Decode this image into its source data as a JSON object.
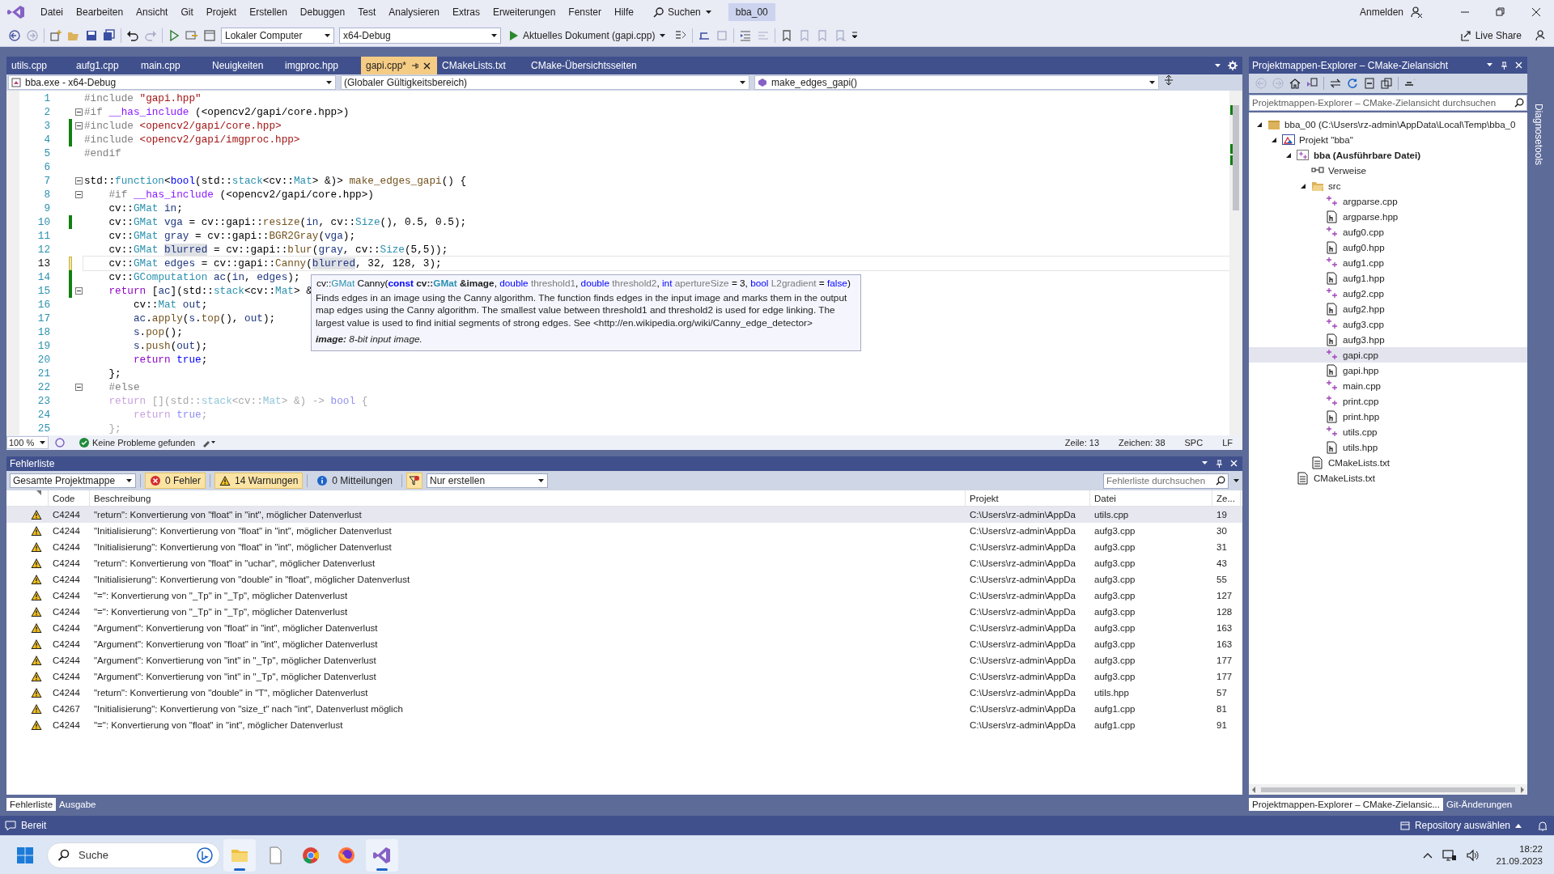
{
  "menu_bar": {
    "items": [
      "Datei",
      "Bearbeiten",
      "Ansicht",
      "Git",
      "Projekt",
      "Erstellen",
      "Debuggen",
      "Test",
      "Analysieren",
      "Extras",
      "Erweiterungen",
      "Fenster",
      "Hilfe"
    ],
    "search": "Suchen",
    "solution_name": "bba_00",
    "sign_in": "Anmelden"
  },
  "toolbar": {
    "target": "Lokaler Computer",
    "configuration": "x64-Debug",
    "run": "Aktuelles Dokument (gapi.cpp)",
    "live_share": "Live Share"
  },
  "editor": {
    "tabs": [
      {
        "label": "utils.cpp",
        "selected": false
      },
      {
        "label": "aufg1.cpp",
        "selected": false
      },
      {
        "label": "main.cpp",
        "selected": false
      },
      {
        "label": "Neuigkeiten",
        "selected": false
      },
      {
        "label": "imgproc.hpp",
        "selected": false
      },
      {
        "label": "gapi.cpp*",
        "selected": true
      },
      {
        "label": "CMakeLists.txt",
        "selected": false
      },
      {
        "label": "CMake-Übersichtsseiten",
        "selected": false
      }
    ],
    "nav": {
      "project": "bba.exe - x64-Debug",
      "scope": "(Globaler Gültigkeitsbereich)",
      "member": "make_edges_gapi()"
    },
    "lines": [
      {
        "number": "1",
        "fold": false,
        "changed": false,
        "current": false,
        "tokens": [
          {
            "kind": "pp",
            "text": "#include "
          },
          {
            "kind": "str",
            "text": "\"gapi.hpp\""
          }
        ]
      },
      {
        "number": "2",
        "fold": true,
        "changed": false,
        "current": false,
        "tokens": [
          {
            "kind": "pp",
            "text": "#if "
          },
          {
            "kind": "mac",
            "text": "__has_include"
          },
          {
            "kind": "plain",
            "text": " (<opencv2/gapi/core.hpp>)"
          }
        ]
      },
      {
        "number": "3",
        "fold": true,
        "changed": true,
        "saved": true,
        "current": false,
        "tokens": [
          {
            "kind": "pp",
            "text": "#include "
          },
          {
            "kind": "str",
            "text": "<opencv2/gapi/core.hpp>"
          }
        ]
      },
      {
        "number": "4",
        "fold": false,
        "changed": true,
        "saved": true,
        "current": false,
        "tokens": [
          {
            "kind": "pp",
            "text": "#include "
          },
          {
            "kind": "str",
            "text": "<opencv2/gapi/imgproc.hpp>"
          }
        ]
      },
      {
        "number": "5",
        "fold": false,
        "changed": false,
        "current": false,
        "tokens": [
          {
            "kind": "pp",
            "text": "#endif"
          }
        ]
      },
      {
        "number": "6",
        "fold": false,
        "changed": false,
        "current": false
      },
      {
        "number": "7",
        "fold": true,
        "changed": false,
        "current": false,
        "tokens": [
          {
            "kind": "plain",
            "text": "std::"
          },
          {
            "kind": "type",
            "text": "function"
          },
          {
            "kind": "plain",
            "text": "<"
          },
          {
            "kind": "kw",
            "text": "bool"
          },
          {
            "kind": "plain",
            "text": "(std::"
          },
          {
            "kind": "type",
            "text": "stack"
          },
          {
            "kind": "plain",
            "text": "<cv::"
          },
          {
            "kind": "type",
            "text": "Mat"
          },
          {
            "kind": "plain",
            "text": "> &)> "
          },
          {
            "kind": "fn",
            "text": "make_edges_gapi"
          },
          {
            "kind": "plain",
            "text": "() {"
          }
        ]
      },
      {
        "number": "8",
        "fold": true,
        "changed": false,
        "current": false,
        "tokens": [
          {
            "kind": "pp",
            "text": "    #if "
          },
          {
            "kind": "mac",
            "text": "__has_include"
          },
          {
            "kind": "plain",
            "text": " (<opencv2/gapi/core.hpp>)"
          }
        ]
      },
      {
        "number": "9",
        "fold": false,
        "changed": false,
        "current": false,
        "tokens": [
          {
            "kind": "plain",
            "text": "    cv::"
          },
          {
            "kind": "type",
            "text": "GMat"
          },
          {
            "kind": "var",
            "text": " in"
          },
          {
            "kind": "plain",
            "text": ";"
          }
        ]
      },
      {
        "number": "10",
        "fold": false,
        "changed": true,
        "saved": true,
        "current": false,
        "tokens": [
          {
            "kind": "plain",
            "text": "    cv::"
          },
          {
            "kind": "type",
            "text": "GMat"
          },
          {
            "kind": "var",
            "text": " vga"
          },
          {
            "kind": "plain",
            "text": " = cv::gapi::"
          },
          {
            "kind": "fn",
            "text": "resize"
          },
          {
            "kind": "plain",
            "text": "("
          },
          {
            "kind": "var",
            "text": "in"
          },
          {
            "kind": "plain",
            "text": ", cv::"
          },
          {
            "kind": "type",
            "text": "Size"
          },
          {
            "kind": "plain",
            "text": "(), 0.5, 0.5);"
          }
        ]
      },
      {
        "number": "11",
        "fold": false,
        "changed": false,
        "current": false,
        "tokens": [
          {
            "kind": "plain",
            "text": "    cv::"
          },
          {
            "kind": "type",
            "text": "GMat"
          },
          {
            "kind": "var",
            "text": " gray"
          },
          {
            "kind": "plain",
            "text": " = cv::gapi::"
          },
          {
            "kind": "fn",
            "text": "BGR2Gray"
          },
          {
            "kind": "plain",
            "text": "("
          },
          {
            "kind": "var",
            "text": "vga"
          },
          {
            "kind": "plain",
            "text": ");"
          }
        ]
      },
      {
        "number": "12",
        "fold": false,
        "changed": false,
        "current": false,
        "tokens": [
          {
            "kind": "plain",
            "text": "    cv::"
          },
          {
            "kind": "type",
            "text": "GMat "
          },
          {
            "kind": "varhl",
            "text": "blurred"
          },
          {
            "kind": "plain",
            "text": " = cv::gapi::"
          },
          {
            "kind": "fn",
            "text": "blur"
          },
          {
            "kind": "plain",
            "text": "("
          },
          {
            "kind": "var",
            "text": "gray"
          },
          {
            "kind": "plain",
            "text": ", cv::"
          },
          {
            "kind": "type",
            "text": "Size"
          },
          {
            "kind": "plain",
            "text": "(5,5));"
          }
        ]
      },
      {
        "number": "13",
        "fold": false,
        "changed": true,
        "saved": false,
        "current": true,
        "tokens": [
          {
            "kind": "plain",
            "text": "    cv::"
          },
          {
            "kind": "type",
            "text": "GMat"
          },
          {
            "kind": "var",
            "text": " edges"
          },
          {
            "kind": "plain",
            "text": " = cv::gapi::"
          },
          {
            "kind": "fn",
            "text": "Canny"
          },
          {
            "kind": "plain",
            "text": "("
          },
          {
            "kind": "varhl",
            "text": "blurred"
          },
          {
            "kind": "plain",
            "text": ", 32, 128, 3);"
          }
        ]
      },
      {
        "number": "14",
        "fold": false,
        "changed": true,
        "saved": true,
        "current": false,
        "tokens": [
          {
            "kind": "plain",
            "text": "    cv::"
          },
          {
            "kind": "type",
            "text": "GComputation"
          },
          {
            "kind": "var",
            "text": " ac"
          },
          {
            "kind": "plain",
            "text": "("
          },
          {
            "kind": "var",
            "text": "in"
          },
          {
            "kind": "plain",
            "text": ", "
          },
          {
            "kind": "var",
            "text": "edges"
          },
          {
            "kind": "plain",
            "text": ");"
          }
        ]
      },
      {
        "number": "15",
        "fold": true,
        "changed": true,
        "saved": true,
        "current": false,
        "tokens": [
          {
            "kind": "ctl",
            "text": "    return"
          },
          {
            "kind": "plain",
            "text": " ["
          },
          {
            "kind": "var",
            "text": "ac"
          },
          {
            "kind": "plain",
            "text": "](std::"
          },
          {
            "kind": "type",
            "text": "stack"
          },
          {
            "kind": "plain",
            "text": "<cv::"
          },
          {
            "kind": "type",
            "text": "Mat"
          },
          {
            "kind": "plain",
            "text": "> &"
          }
        ]
      },
      {
        "number": "16",
        "fold": false,
        "changed": false,
        "current": false,
        "tokens": [
          {
            "kind": "plain",
            "text": "        cv::"
          },
          {
            "kind": "type",
            "text": "Mat"
          },
          {
            "kind": "var",
            "text": " out"
          },
          {
            "kind": "plain",
            "text": ";"
          }
        ]
      },
      {
        "number": "17",
        "fold": false,
        "changed": false,
        "current": false,
        "tokens": [
          {
            "kind": "var",
            "text": "        ac"
          },
          {
            "kind": "plain",
            "text": "."
          },
          {
            "kind": "fn",
            "text": "apply"
          },
          {
            "kind": "plain",
            "text": "("
          },
          {
            "kind": "var",
            "text": "s"
          },
          {
            "kind": "plain",
            "text": "."
          },
          {
            "kind": "fn",
            "text": "top"
          },
          {
            "kind": "plain",
            "text": "(), "
          },
          {
            "kind": "var",
            "text": "out"
          },
          {
            "kind": "plain",
            "text": ");"
          }
        ]
      },
      {
        "number": "18",
        "fold": false,
        "changed": false,
        "current": false,
        "tokens": [
          {
            "kind": "var",
            "text": "        s"
          },
          {
            "kind": "plain",
            "text": "."
          },
          {
            "kind": "fn",
            "text": "pop"
          },
          {
            "kind": "plain",
            "text": "();"
          }
        ]
      },
      {
        "number": "19",
        "fold": false,
        "changed": false,
        "current": false,
        "tokens": [
          {
            "kind": "var",
            "text": "        s"
          },
          {
            "kind": "plain",
            "text": "."
          },
          {
            "kind": "fn",
            "text": "push"
          },
          {
            "kind": "plain",
            "text": "("
          },
          {
            "kind": "var",
            "text": "out"
          },
          {
            "kind": "plain",
            "text": ");"
          }
        ]
      },
      {
        "number": "20",
        "fold": false,
        "changed": false,
        "current": false,
        "tokens": [
          {
            "kind": "ctl",
            "text": "        return"
          },
          {
            "kind": "kw",
            "text": " true"
          },
          {
            "kind": "plain",
            "text": ";"
          }
        ]
      },
      {
        "number": "21",
        "fold": false,
        "changed": false,
        "current": false,
        "tokens": [
          {
            "kind": "plain",
            "text": "    };"
          }
        ]
      },
      {
        "number": "22",
        "fold": true,
        "changed": false,
        "current": false,
        "tokens": [
          {
            "kind": "pp",
            "text": "    #else"
          }
        ]
      },
      {
        "number": "23",
        "fold": false,
        "changed": false,
        "current": false,
        "tokens": [
          {
            "kind": "dimctl",
            "text": "    return"
          },
          {
            "kind": "dim",
            "text": " [](std::"
          },
          {
            "kind": "dimtype",
            "text": "stack"
          },
          {
            "kind": "dim",
            "text": "<cv::"
          },
          {
            "kind": "dimtype",
            "text": "Mat"
          },
          {
            "kind": "dim",
            "text": "> &) -> "
          },
          {
            "kind": "dimkw",
            "text": "bool"
          },
          {
            "kind": "dim",
            "text": " {"
          }
        ]
      },
      {
        "number": "24",
        "fold": false,
        "changed": false,
        "current": false,
        "tokens": [
          {
            "kind": "dimctl",
            "text": "        return"
          },
          {
            "kind": "dimkw",
            "text": " true"
          },
          {
            "kind": "dim",
            "text": ";"
          }
        ]
      },
      {
        "number": "25",
        "fold": false,
        "changed": false,
        "current": false,
        "tokens": [
          {
            "kind": "dim",
            "text": "    };"
          }
        ]
      }
    ],
    "tooltip": {
      "signature": [
        {
          "kind": "plain",
          "text": "cv::"
        },
        {
          "kind": "type",
          "text": "GMat"
        },
        {
          "kind": "plain",
          "text": " Canny("
        },
        {
          "kind": "kwb",
          "text": "const"
        },
        {
          "kind": "plainb",
          "text": " cv::"
        },
        {
          "kind": "typeb",
          "text": "GMat"
        },
        {
          "kind": "plainb",
          "text": " &image"
        },
        {
          "kind": "plain",
          "text": ", "
        },
        {
          "kind": "kw",
          "text": "double"
        },
        {
          "kind": "param",
          "text": " threshold1"
        },
        {
          "kind": "plain",
          "text": ", "
        },
        {
          "kind": "kw",
          "text": "double"
        },
        {
          "kind": "param",
          "text": " threshold2"
        },
        {
          "kind": "plain",
          "text": ", "
        },
        {
          "kind": "kw",
          "text": "int"
        },
        {
          "kind": "param",
          "text": " apertureSize"
        },
        {
          "kind": "plain",
          "text": " = 3, "
        },
        {
          "kind": "kw",
          "text": "bool"
        },
        {
          "kind": "param",
          "text": " L2gradient"
        },
        {
          "kind": "plain",
          "text": " = "
        },
        {
          "kind": "kw",
          "text": "false"
        },
        {
          "kind": "plain",
          "text": ")"
        }
      ],
      "description": "Finds edges in an image using the Canny algorithm. The function finds edges in the input image and marks them in the output map edges using the Canny algorithm. The smallest value between threshold1 and threshold2 is used for edge linking. The largest value is used to find initial segments of strong edges. See <http://en.wikipedia.org/wiki/Canny_edge_detector>",
      "parameter": "**image:** 8-bit input image."
    },
    "status": {
      "zoom": "100 %",
      "issues": "Keine Probleme gefunden",
      "line": "Zeile: 13",
      "column": "Zeichen: 38",
      "indent": "SPC",
      "line_ending": "LF"
    }
  },
  "error_list": {
    "title": "Fehlerliste",
    "scope": "Gesamte Projektmappe",
    "filters": [
      {
        "kind": "error",
        "label": "0 Fehler",
        "on": true
      },
      {
        "kind": "warning",
        "label": "14 Warnungen",
        "on": true
      },
      {
        "kind": "message",
        "label": "0 Mitteilungen",
        "on": false
      }
    ],
    "build_filter": "Nur erstellen",
    "search": {
      "placeholder": "Fehlerliste durchsuchen"
    },
    "columns": [
      "Code",
      "Beschreibung",
      "Projekt",
      "Datei",
      "Ze..."
    ],
    "rows": [
      {
        "code": "C4244",
        "description": "\"return\": Konvertierung von \"float\" in \"int\", möglicher Datenverlust",
        "project": "C:\\Users\\rz-admin\\AppDa",
        "file": "utils.cpp",
        "line": "19",
        "selected": true
      },
      {
        "code": "C4244",
        "description": "\"Initialisierung\": Konvertierung von \"float\" in \"int\", möglicher Datenverlust",
        "project": "C:\\Users\\rz-admin\\AppDa",
        "file": "aufg3.cpp",
        "line": "30",
        "selected": false
      },
      {
        "code": "C4244",
        "description": "\"Initialisierung\": Konvertierung von \"float\" in \"int\", möglicher Datenverlust",
        "project": "C:\\Users\\rz-admin\\AppDa",
        "file": "aufg3.cpp",
        "line": "31",
        "selected": false
      },
      {
        "code": "C4244",
        "description": "\"return\": Konvertierung von \"float\" in \"uchar\", möglicher Datenverlust",
        "project": "C:\\Users\\rz-admin\\AppDa",
        "file": "aufg3.cpp",
        "line": "43",
        "selected": false
      },
      {
        "code": "C4244",
        "description": "\"Initialisierung\": Konvertierung von \"double\" in \"float\", möglicher Datenverlust",
        "project": "C:\\Users\\rz-admin\\AppDa",
        "file": "aufg3.cpp",
        "line": "55",
        "selected": false
      },
      {
        "code": "C4244",
        "description": "\"=\": Konvertierung von \"_Tp\" in \"_Tp\", möglicher Datenverlust",
        "project": "C:\\Users\\rz-admin\\AppDa",
        "file": "aufg3.cpp",
        "line": "127",
        "selected": false
      },
      {
        "code": "C4244",
        "description": "\"=\": Konvertierung von \"_Tp\" in \"_Tp\", möglicher Datenverlust",
        "project": "C:\\Users\\rz-admin\\AppDa",
        "file": "aufg3.cpp",
        "line": "128",
        "selected": false
      },
      {
        "code": "C4244",
        "description": "\"Argument\": Konvertierung von \"float\" in \"int\", möglicher Datenverlust",
        "project": "C:\\Users\\rz-admin\\AppDa",
        "file": "aufg3.cpp",
        "line": "163",
        "selected": false
      },
      {
        "code": "C4244",
        "description": "\"Argument\": Konvertierung von \"float\" in \"int\", möglicher Datenverlust",
        "project": "C:\\Users\\rz-admin\\AppDa",
        "file": "aufg3.cpp",
        "line": "163",
        "selected": false
      },
      {
        "code": "C4244",
        "description": "\"Argument\": Konvertierung von \"int\" in \"_Tp\", möglicher Datenverlust",
        "project": "C:\\Users\\rz-admin\\AppDa",
        "file": "aufg3.cpp",
        "line": "177",
        "selected": false
      },
      {
        "code": "C4244",
        "description": "\"Argument\": Konvertierung von \"int\" in \"_Tp\", möglicher Datenverlust",
        "project": "C:\\Users\\rz-admin\\AppDa",
        "file": "aufg3.cpp",
        "line": "177",
        "selected": false
      },
      {
        "code": "C4244",
        "description": "\"return\": Konvertierung von \"double\" in \"T\", möglicher Datenverlust",
        "project": "C:\\Users\\rz-admin\\AppDa",
        "file": "utils.hpp",
        "line": "57",
        "selected": false
      },
      {
        "code": "C4267",
        "description": "\"Initialisierung\": Konvertierung von \"size_t\" nach \"int\", Datenverlust möglich",
        "project": "C:\\Users\\rz-admin\\AppDa",
        "file": "aufg1.cpp",
        "line": "81",
        "selected": false
      },
      {
        "code": "C4244",
        "description": "\"=\": Konvertierung von \"float\" in \"int\", möglicher Datenverlust",
        "project": "C:\\Users\\rz-admin\\AppDa",
        "file": "aufg1.cpp",
        "line": "91",
        "selected": false
      }
    ],
    "tabs": [
      {
        "label": "Fehlerliste",
        "selected": true
      },
      {
        "label": "Ausgabe",
        "selected": false
      }
    ]
  },
  "solution_explorer": {
    "title": "Projektmappen-Explorer – CMake-Zielansicht",
    "search": {
      "placeholder": "Projektmappen-Explorer – CMake-Zielansicht durchsuchen"
    },
    "tree": [
      {
        "kind": "solution",
        "label": "bba_00 (C:\\Users\\rz-admin\\AppData\\Local\\Temp\\bba_0",
        "expanded": true,
        "selected": false,
        "children": [
          {
            "kind": "project",
            "label": "Projekt \"bba\"",
            "expanded": true,
            "selected": false,
            "children": [
              {
                "kind": "target",
                "label": "bba (Ausführbare Datei)",
                "expanded": true,
                "selected": false,
                "children": [
                  {
                    "kind": "references",
                    "label": "Verweise",
                    "selected": false
                  },
                  {
                    "kind": "folder",
                    "label": "src",
                    "expanded": true,
                    "selected": false,
                    "children": [
                      {
                        "kind": "cpp",
                        "label": "argparse.cpp",
                        "selected": false
                      },
                      {
                        "kind": "hpp",
                        "label": "argparse.hpp",
                        "selected": false
                      },
                      {
                        "kind": "cpp",
                        "label": "aufg0.cpp",
                        "selected": false
                      },
                      {
                        "kind": "hpp",
                        "label": "aufg0.hpp",
                        "selected": false
                      },
                      {
                        "kind": "cpp",
                        "label": "aufg1.cpp",
                        "selected": false
                      },
                      {
                        "kind": "hpp",
                        "label": "aufg1.hpp",
                        "selected": false
                      },
                      {
                        "kind": "cpp",
                        "label": "aufg2.cpp",
                        "selected": false
                      },
                      {
                        "kind": "hpp",
                        "label": "aufg2.hpp",
                        "selected": false
                      },
                      {
                        "kind": "cpp",
                        "label": "aufg3.cpp",
                        "selected": false
                      },
                      {
                        "kind": "hpp",
                        "label": "aufg3.hpp",
                        "selected": false
                      },
                      {
                        "kind": "cpp",
                        "label": "gapi.cpp",
                        "selected": true
                      },
                      {
                        "kind": "hpp",
                        "label": "gapi.hpp",
                        "selected": false
                      },
                      {
                        "kind": "cpp",
                        "label": "main.cpp",
                        "selected": false
                      },
                      {
                        "kind": "cpp",
                        "label": "print.cpp",
                        "selected": false
                      },
                      {
                        "kind": "hpp",
                        "label": "print.hpp",
                        "selected": false
                      },
                      {
                        "kind": "cpp",
                        "label": "utils.cpp",
                        "selected": false
                      },
                      {
                        "kind": "hpp",
                        "label": "utils.hpp",
                        "selected": false
                      }
                    ]
                  },
                  {
                    "kind": "text",
                    "label": "CMakeLists.txt",
                    "selected": false
                  }
                ]
              },
              {
                "kind": "text",
                "label": "CMakeLists.txt",
                "selected": false
              }
            ]
          }
        ]
      }
    ],
    "tabs": [
      {
        "label": "Projektmappen-Explorer – CMake-Zielansic...",
        "selected": true
      },
      {
        "label": "Git-Änderungen",
        "selected": false
      }
    ]
  },
  "side_strip": {
    "label": "Diagnosetools"
  },
  "status_bar": {
    "text": "Bereit",
    "repository": "Repository auswählen"
  },
  "taskbar": {
    "search": {
      "placeholder": "Suche"
    },
    "time": "18:22",
    "date": "21.09.2023"
  }
}
